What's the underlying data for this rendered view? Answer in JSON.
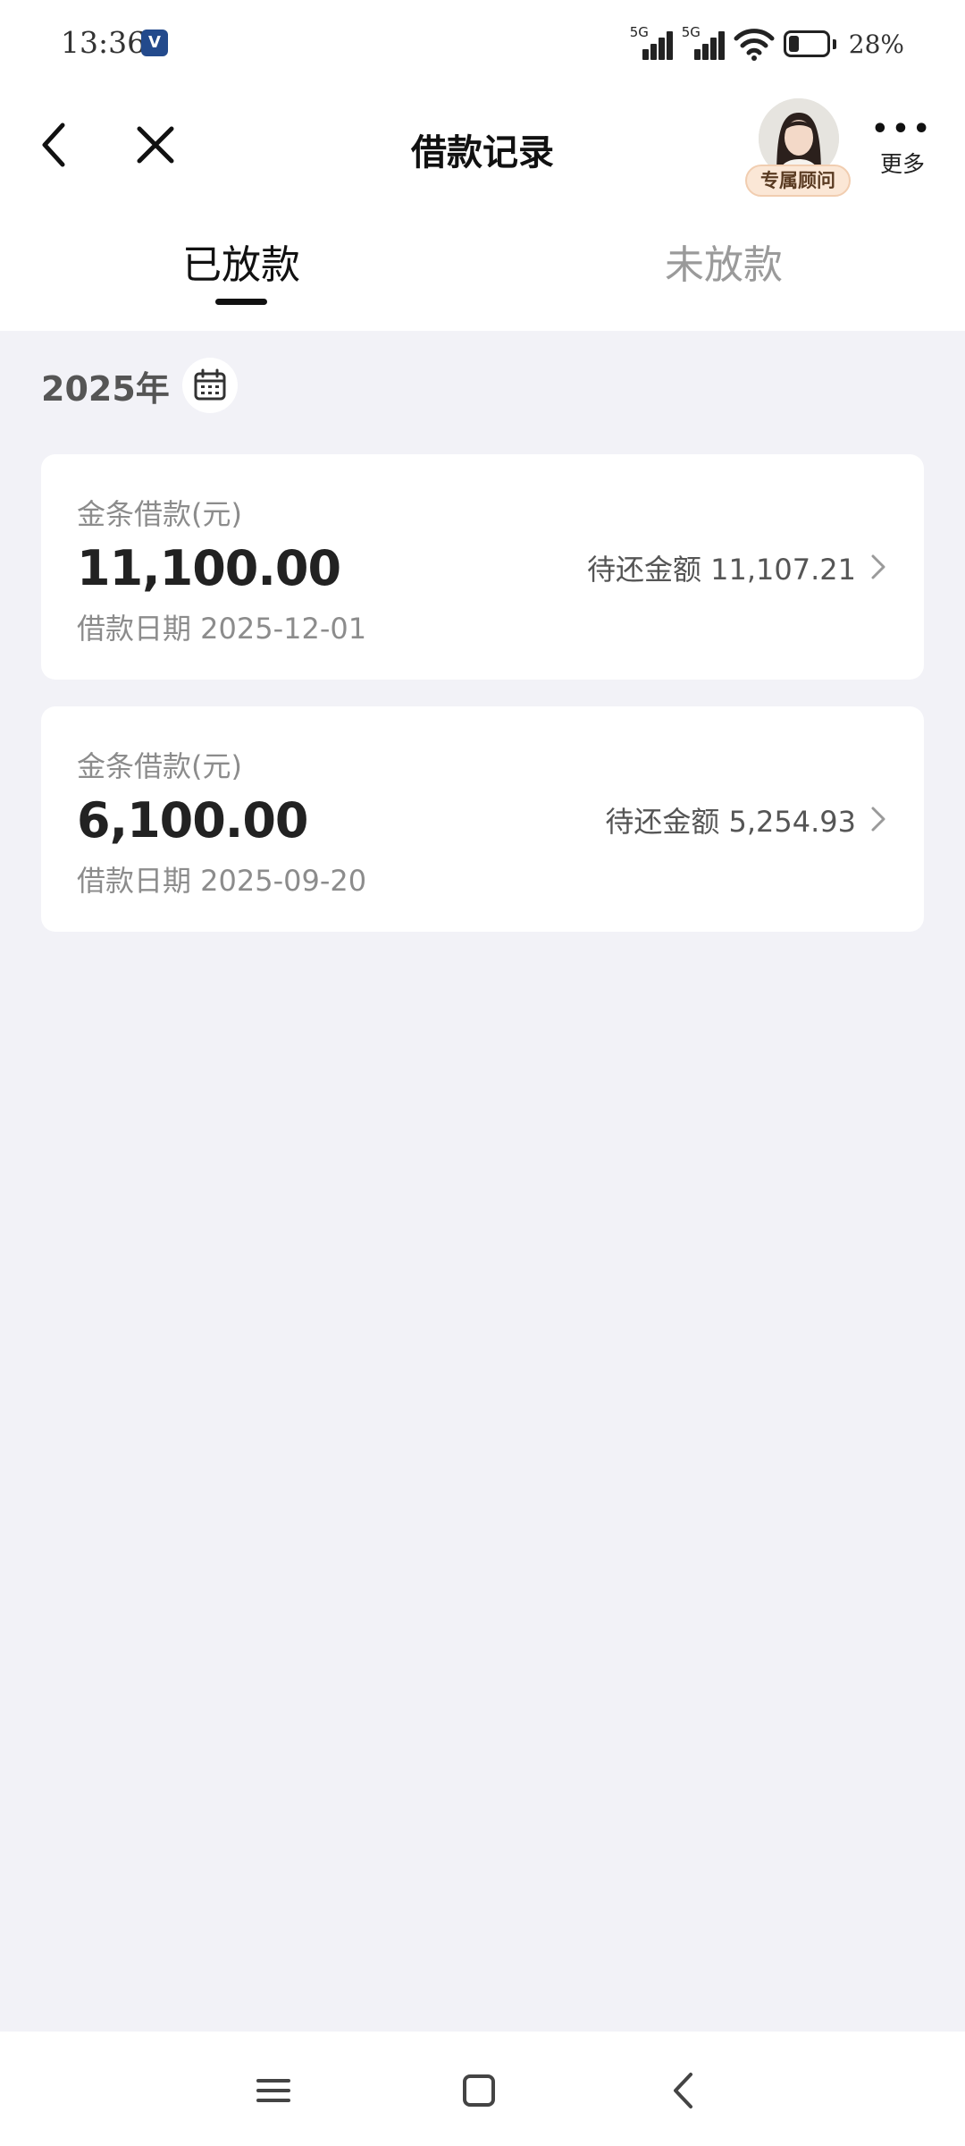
{
  "status_bar": {
    "time": "13:36",
    "app_icon_glyph": "V",
    "signal_1_label": "5G",
    "signal_2_label": "5G",
    "battery_percent": 28,
    "battery_text": "28%"
  },
  "header": {
    "title": "借款记录",
    "advisor_badge": "专属顾问",
    "more_label": "更多"
  },
  "tabs": [
    {
      "label": "已放款",
      "active": true
    },
    {
      "label": "未放款",
      "active": false
    }
  ],
  "year_filter": {
    "label": "2025年"
  },
  "loans": [
    {
      "type": "金条借款(元)",
      "amount": "11,100.00",
      "due_label": "待还金额 11,107.21",
      "date_label": "借款日期 2025-12-01"
    },
    {
      "type": "金条借款(元)",
      "amount": "6,100.00",
      "due_label": "待还金额 5,254.93",
      "date_label": "借款日期 2025-09-20"
    }
  ],
  "icons": {
    "back": "back-arrow-icon",
    "close": "close-icon",
    "calendar": "calendar-icon",
    "chevron": "chevron-right-icon",
    "menu": "menu-icon",
    "home": "home-icon",
    "nav_back": "nav-back-icon"
  },
  "colors": {
    "background": "#f2f2f7",
    "card": "#ffffff",
    "text_primary": "#222222",
    "text_secondary": "#8c8c8c",
    "tab_inactive": "#9a9a9a",
    "badge_bg": "#fbe7d6"
  }
}
